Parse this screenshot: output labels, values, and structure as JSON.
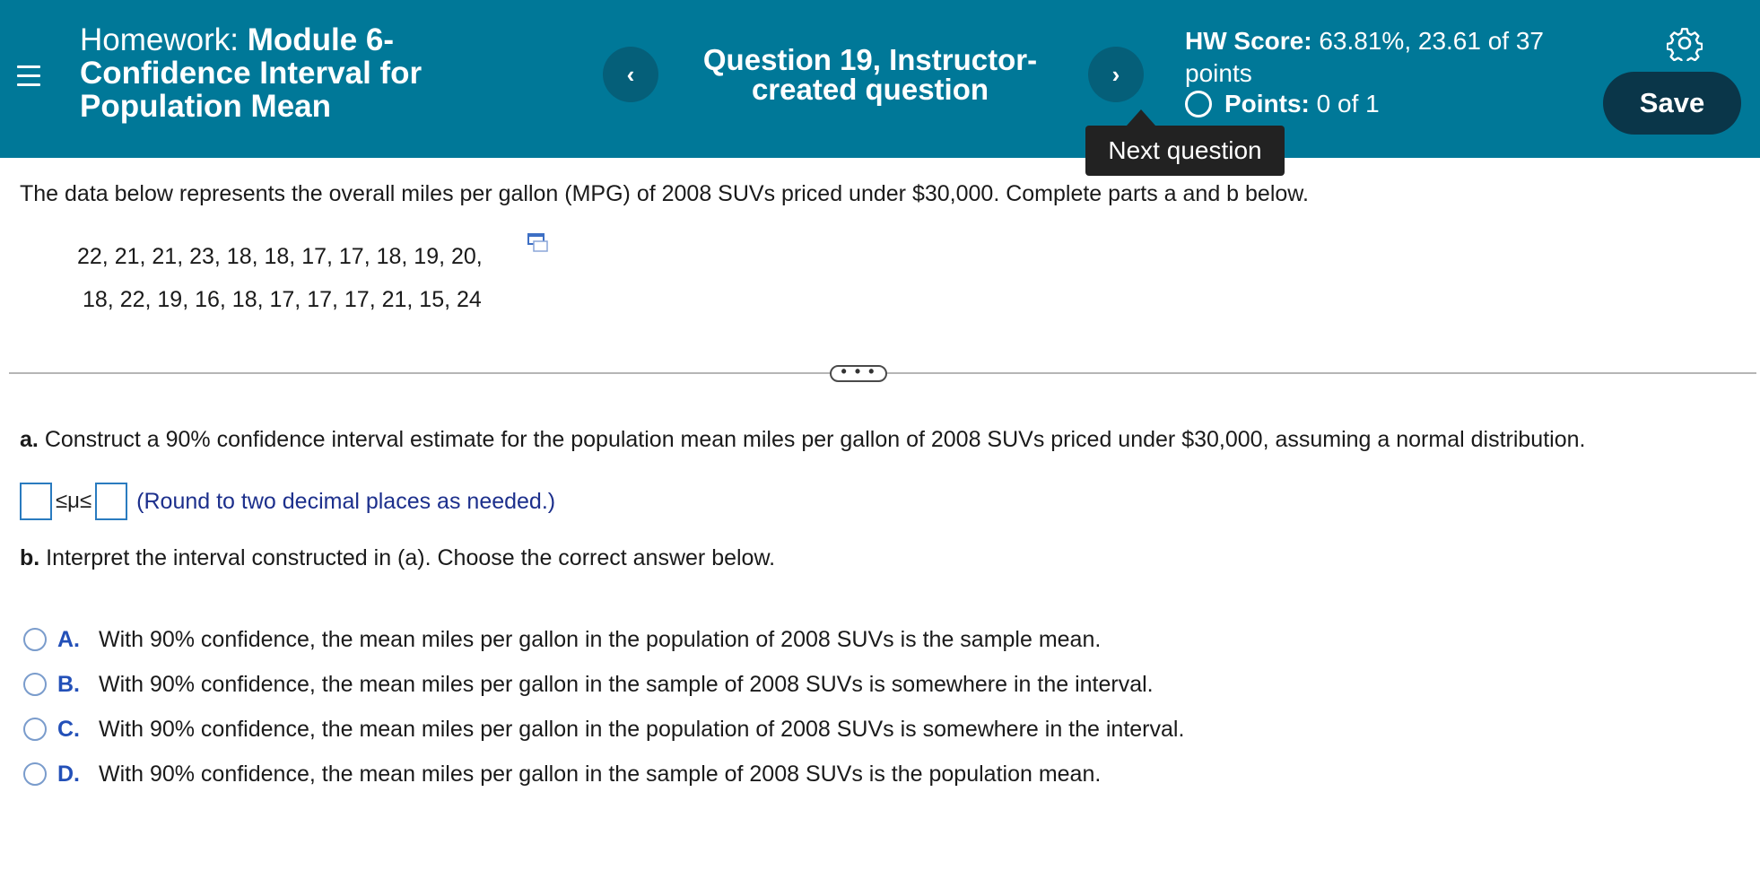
{
  "header": {
    "hw_prefix": "Homework:",
    "hw_name": "Module 6-Confidence Interval for Population Mean",
    "question_title": "Question 19, Instructor-created question",
    "score_label": "HW Score:",
    "score_value": "63.81%, 23.61 of 37 points",
    "points_label": "Points:",
    "points_value": "0 of 1",
    "save_label": "Save",
    "prev_icon": "‹",
    "next_icon": "›",
    "tooltip": "Next question",
    "colors": {
      "header_bg": "#007898",
      "nav_btn": "#055f79",
      "save_bg": "#0a3649"
    }
  },
  "problem": {
    "intro": "The data below represents the overall miles per gallon (MPG) of 2008 SUVs priced under $30,000. Complete parts a and b below.",
    "data_line_1": "22, 21, 21, 23, 18, 18, 17, 17, 18, 19, 20,",
    "data_line_2": "18, 22, 19, 16, 18, 17, 17, 17, 21, 15, 24",
    "expand_label": "• • •"
  },
  "part_a": {
    "label": "a.",
    "text": "Construct a 90% confidence interval estimate for the population mean miles per gallon of 2008 SUVs priced under $30,000, assuming a normal distribution.",
    "inequality": "≤μ≤",
    "hint": "(Round to two decimal places as needed.)",
    "lower_value": "",
    "upper_value": ""
  },
  "part_b": {
    "label": "b.",
    "text": "Interpret the interval constructed in (a).  Choose the correct answer below.",
    "choices": [
      {
        "letter": "A.",
        "text": "With 90% confidence, the mean miles per gallon in the population of 2008 SUVs is the sample mean."
      },
      {
        "letter": "B.",
        "text": "With 90% confidence, the mean miles per gallon in the sample of 2008 SUVs is somewhere in the interval."
      },
      {
        "letter": "C.",
        "text": "With 90% confidence, the mean miles per gallon in the population of 2008 SUVs is somewhere in the interval."
      },
      {
        "letter": "D.",
        "text": "With 90% confidence, the mean miles per gallon in the sample of 2008 SUVs is the population mean."
      }
    ]
  }
}
